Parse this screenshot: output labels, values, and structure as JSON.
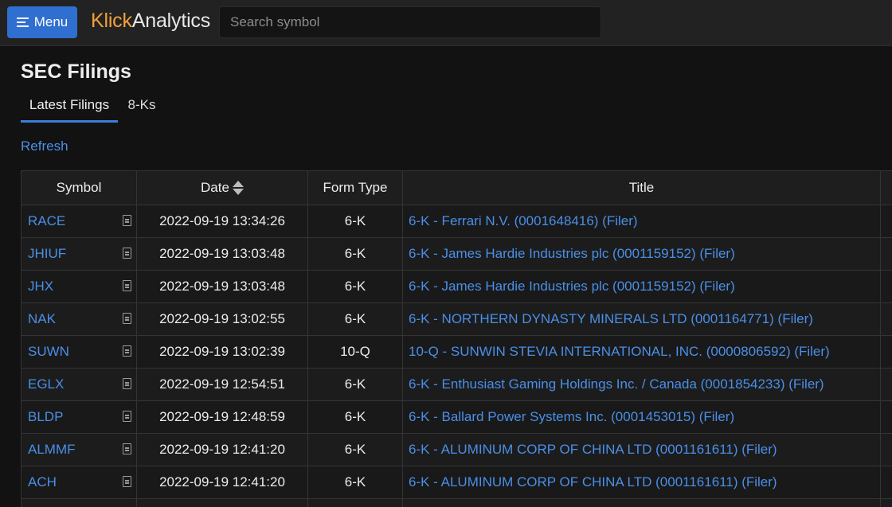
{
  "header": {
    "menu_label": "Menu",
    "logo_part1": "Klick",
    "logo_part2": "Analytics",
    "search_placeholder": "Search symbol",
    "search_value": ""
  },
  "page": {
    "title": "SEC Filings",
    "tabs": [
      {
        "label": "Latest Filings",
        "active": true
      },
      {
        "label": "8-Ks",
        "active": false
      }
    ],
    "refresh_label": "Refresh"
  },
  "table": {
    "columns": [
      "Symbol",
      "Date",
      "Form Type",
      "Title"
    ],
    "rows": [
      {
        "symbol": "RACE",
        "date": "2022-09-19 13:34:26",
        "form": "6-K",
        "title": "6-K - Ferrari N.V. (0001648416) (Filer)"
      },
      {
        "symbol": "JHIUF",
        "date": "2022-09-19 13:03:48",
        "form": "6-K",
        "title": "6-K - James Hardie Industries plc (0001159152) (Filer)"
      },
      {
        "symbol": "JHX",
        "date": "2022-09-19 13:03:48",
        "form": "6-K",
        "title": "6-K - James Hardie Industries plc (0001159152) (Filer)"
      },
      {
        "symbol": "NAK",
        "date": "2022-09-19 13:02:55",
        "form": "6-K",
        "title": "6-K - NORTHERN DYNASTY MINERALS LTD (0001164771) (Filer)"
      },
      {
        "symbol": "SUWN",
        "date": "2022-09-19 13:02:39",
        "form": "10-Q",
        "title": "10-Q - SUNWIN STEVIA INTERNATIONAL, INC. (0000806592) (Filer)"
      },
      {
        "symbol": "EGLX",
        "date": "2022-09-19 12:54:51",
        "form": "6-K",
        "title": "6-K - Enthusiast Gaming Holdings Inc. / Canada (0001854233) (Filer)"
      },
      {
        "symbol": "BLDP",
        "date": "2022-09-19 12:48:59",
        "form": "6-K",
        "title": "6-K - Ballard Power Systems Inc. (0001453015) (Filer)"
      },
      {
        "symbol": "ALMMF",
        "date": "2022-09-19 12:41:20",
        "form": "6-K",
        "title": "6-K - ALUMINUM CORP OF CHINA LTD (0001161611) (Filer)"
      },
      {
        "symbol": "ACH",
        "date": "2022-09-19 12:41:20",
        "form": "6-K",
        "title": "6-K - ALUMINUM CORP OF CHINA LTD (0001161611) (Filer)"
      }
    ]
  },
  "colors": {
    "accent": "#2f6fd0",
    "link": "#4a8fe8",
    "logo_orange": "#f0a23a",
    "background": "#121212"
  },
  "icons": {
    "menu": "hamburger-icon",
    "symbol_doc": "document-icon",
    "sort": "sort-icon"
  }
}
